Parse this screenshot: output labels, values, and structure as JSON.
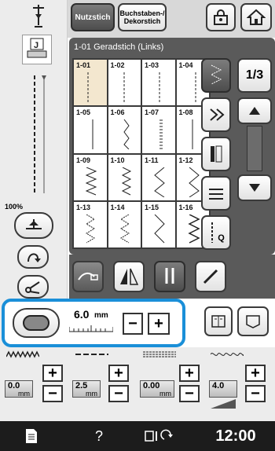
{
  "header": {
    "tab_utility": "Nutzstich",
    "tab_letters": "Buchstaben-/ Dekorstich"
  },
  "left": {
    "speed_percent": "100%"
  },
  "panel": {
    "title": "1-01  Geradstich (Links)",
    "page_label": "1/3",
    "q_label": "Q",
    "stitches": [
      {
        "num": "1-01"
      },
      {
        "num": "1-02"
      },
      {
        "num": "1-03"
      },
      {
        "num": "1-04"
      },
      {
        "num": "1-05"
      },
      {
        "num": "1-06"
      },
      {
        "num": "1-07"
      },
      {
        "num": "1-08"
      },
      {
        "num": "1-09"
      },
      {
        "num": "1-10"
      },
      {
        "num": "1-11"
      },
      {
        "num": "1-12"
      },
      {
        "num": "1-13"
      },
      {
        "num": "1-14"
      },
      {
        "num": "1-15"
      },
      {
        "num": "1-16"
      }
    ]
  },
  "width_control": {
    "value": "6.0",
    "unit": "mm"
  },
  "settings": [
    {
      "name": "stitch-width",
      "value": "0.0",
      "unit": "mm"
    },
    {
      "name": "stitch-length",
      "value": "2.5",
      "unit": "mm"
    },
    {
      "name": "l-r-shift",
      "value": "0.00",
      "unit": "mm"
    },
    {
      "name": "thread-tension",
      "value": "4.0",
      "unit": ""
    }
  ],
  "controls": {
    "plus": "+",
    "minus": "−"
  },
  "statusbar": {
    "help": "?",
    "clock": "12:00"
  },
  "colors": {
    "highlight": "#1a8fd8",
    "panel": "#5a5a5a",
    "selected_cell": "#f3e7cf"
  },
  "icons": [
    "needle-position-icon",
    "presser-foot-j-icon",
    "home-icon",
    "lock-icon",
    "thread-cutter-icon",
    "mirror-icon",
    "twin-needle-icon",
    "pencil-icon",
    "memory-icon",
    "pocket-icon",
    "document-icon",
    "embroidery-icon"
  ]
}
